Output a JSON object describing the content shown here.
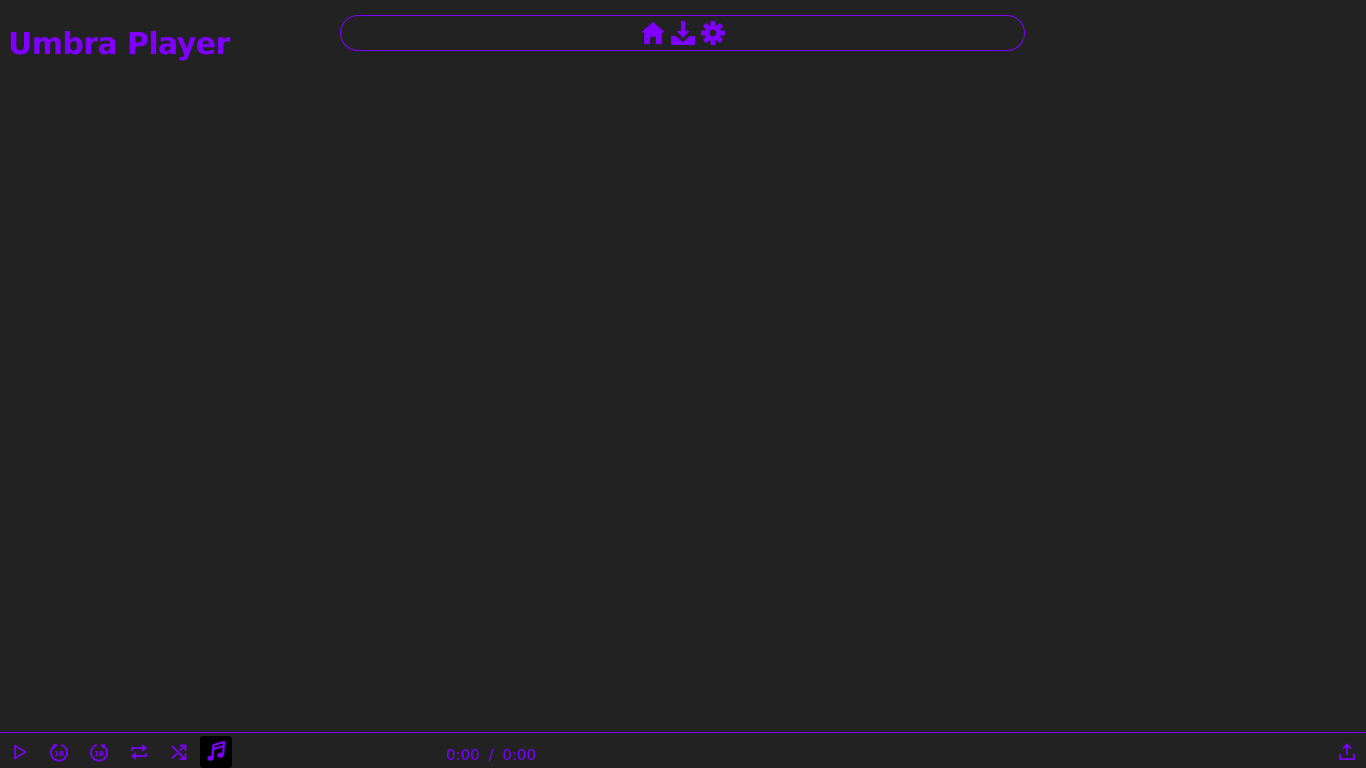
{
  "app": {
    "title": "Umbra Player",
    "accent_color": "#7f00ff",
    "background_color": "#222222"
  },
  "nav": {
    "items": [
      {
        "icon": "home-icon"
      },
      {
        "icon": "download-icon"
      },
      {
        "icon": "gear-icon"
      }
    ]
  },
  "player": {
    "controls": [
      {
        "icon": "play-icon"
      },
      {
        "icon": "rewind-10-icon",
        "label": "10"
      },
      {
        "icon": "forward-10-icon",
        "label": "10"
      },
      {
        "icon": "repeat-icon"
      },
      {
        "icon": "shuffle-icon"
      },
      {
        "icon": "music-note-icon",
        "active": true
      }
    ],
    "current_time": "0:00",
    "separator": "/",
    "duration": "0:00",
    "upload_icon": "upload-icon"
  }
}
